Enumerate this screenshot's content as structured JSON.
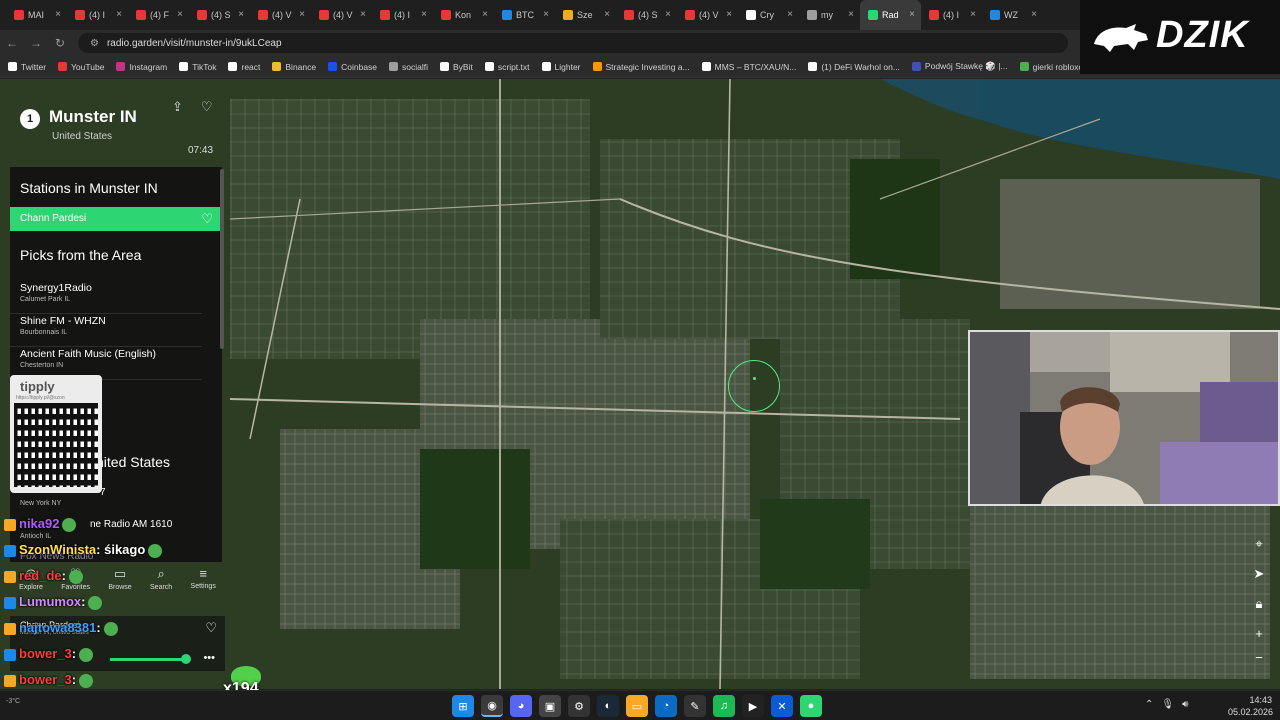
{
  "browser": {
    "tabs": [
      {
        "label": "MAI",
        "color": "#e53935"
      },
      {
        "label": "(4) I",
        "color": "#e53935"
      },
      {
        "label": "(4) F",
        "color": "#e53935"
      },
      {
        "label": "(4) S",
        "color": "#e53935"
      },
      {
        "label": "(4) V",
        "color": "#e53935"
      },
      {
        "label": "(4) V",
        "color": "#e53935"
      },
      {
        "label": "(4) I",
        "color": "#e53935"
      },
      {
        "label": "Kon",
        "color": "#e53935"
      },
      {
        "label": "BTC",
        "color": "#1e88e5"
      },
      {
        "label": "Sze",
        "color": "#f9a825"
      },
      {
        "label": "(4) S",
        "color": "#e53935"
      },
      {
        "label": "(4) V",
        "color": "#e53935"
      },
      {
        "label": "Cry",
        "color": "#ffffff"
      },
      {
        "label": "my",
        "color": "#9e9e9e"
      },
      {
        "label": "Rad",
        "color": "#2ed573",
        "active": true
      },
      {
        "label": "(4) I",
        "color": "#e53935"
      },
      {
        "label": "WZ",
        "color": "#1e88e5"
      }
    ],
    "url": "radio.garden/visit/munster-in/9ukLCeap",
    "bookmarks": [
      {
        "label": "Twitter",
        "color": "#ffffff"
      },
      {
        "label": "YouTube",
        "color": "#e53935"
      },
      {
        "label": "Instagram",
        "color": "#c13584"
      },
      {
        "label": "TikTok",
        "color": "#ffffff"
      },
      {
        "label": "react",
        "color": "#ffffff"
      },
      {
        "label": "Binance",
        "color": "#f3ba2f"
      },
      {
        "label": "Coinbase",
        "color": "#1652f0"
      },
      {
        "label": "socialfi",
        "color": "#9e9e9e"
      },
      {
        "label": "ByBit",
        "color": "#ffffff"
      },
      {
        "label": "script.txt",
        "color": "#ffffff"
      },
      {
        "label": "Lighter",
        "color": "#ffffff"
      },
      {
        "label": "Strategic Investing a...",
        "color": "#ff9800"
      },
      {
        "label": "MMS – BTC/XAU/N...",
        "color": "#ffffff"
      },
      {
        "label": "(1) DeFi Warhol on...",
        "color": "#ffffff"
      },
      {
        "label": "Podwój Stawkę 🎲 |...",
        "color": "#3f51b5"
      },
      {
        "label": "gierki robloxowe do",
        "color": "#4caf50"
      }
    ]
  },
  "radio": {
    "station_count_badge": "1",
    "city": "Munster IN",
    "country": "United States",
    "local_time": "07:43",
    "stations_heading": "Stations in Munster IN",
    "active_station": "Chann Pardesi",
    "picks_heading": "Picks from the Area",
    "picks": [
      {
        "name": "Synergy1Radio",
        "location": "Calumet Park IL"
      },
      {
        "name": "Shine FM - WHZN",
        "location": "Bourbonnais IL"
      },
      {
        "name": "Ancient Faith Music (English)",
        "location": "Chesterton IN"
      }
    ],
    "partial_heading": "nited States",
    "partial_item_a": "7",
    "partial_item_a_loc": "New York NY",
    "partial_item_b": "ne Radio AM 1610",
    "partial_item_b_loc": "Antioch IL",
    "partial_item_c": "Fox News Radio",
    "nav": [
      "Explore",
      "Favorites",
      "Browse",
      "Search",
      "Settings"
    ],
    "player_station": "Chann Pardesi",
    "player_location": "Munster IN, United States",
    "volume_fraction": 0.95
  },
  "qr": {
    "title": "tipply",
    "url": "https://tipply.pl/@szon"
  },
  "chat": [
    {
      "user": "nika92",
      "text": "",
      "color": "#b05cff"
    },
    {
      "user": "SzonWinista",
      "text": ": śikago",
      "color": "#ffe14a"
    },
    {
      "user": "red_de",
      "text": ":",
      "color": "#ff3b3b"
    },
    {
      "user": "Lumumox",
      "text": ":",
      "color": "#d08aff"
    },
    {
      "user": "najtowa8381",
      "text": ":",
      "color": "#3aa0ff"
    },
    {
      "user": "bower_3",
      "text": ":",
      "color": "#ff3b3b"
    },
    {
      "user": "bower_3",
      "text": ":",
      "color": "#ff3b3b"
    },
    {
      "user": "bower_3",
      "text": ":",
      "color": "#ff3b3b"
    }
  ],
  "overlay": {
    "emote_count": "x194",
    "logo_text": "DZIK"
  },
  "taskbar": {
    "weather": "-3°C",
    "time": "14:43",
    "date": "05.02.2026"
  }
}
